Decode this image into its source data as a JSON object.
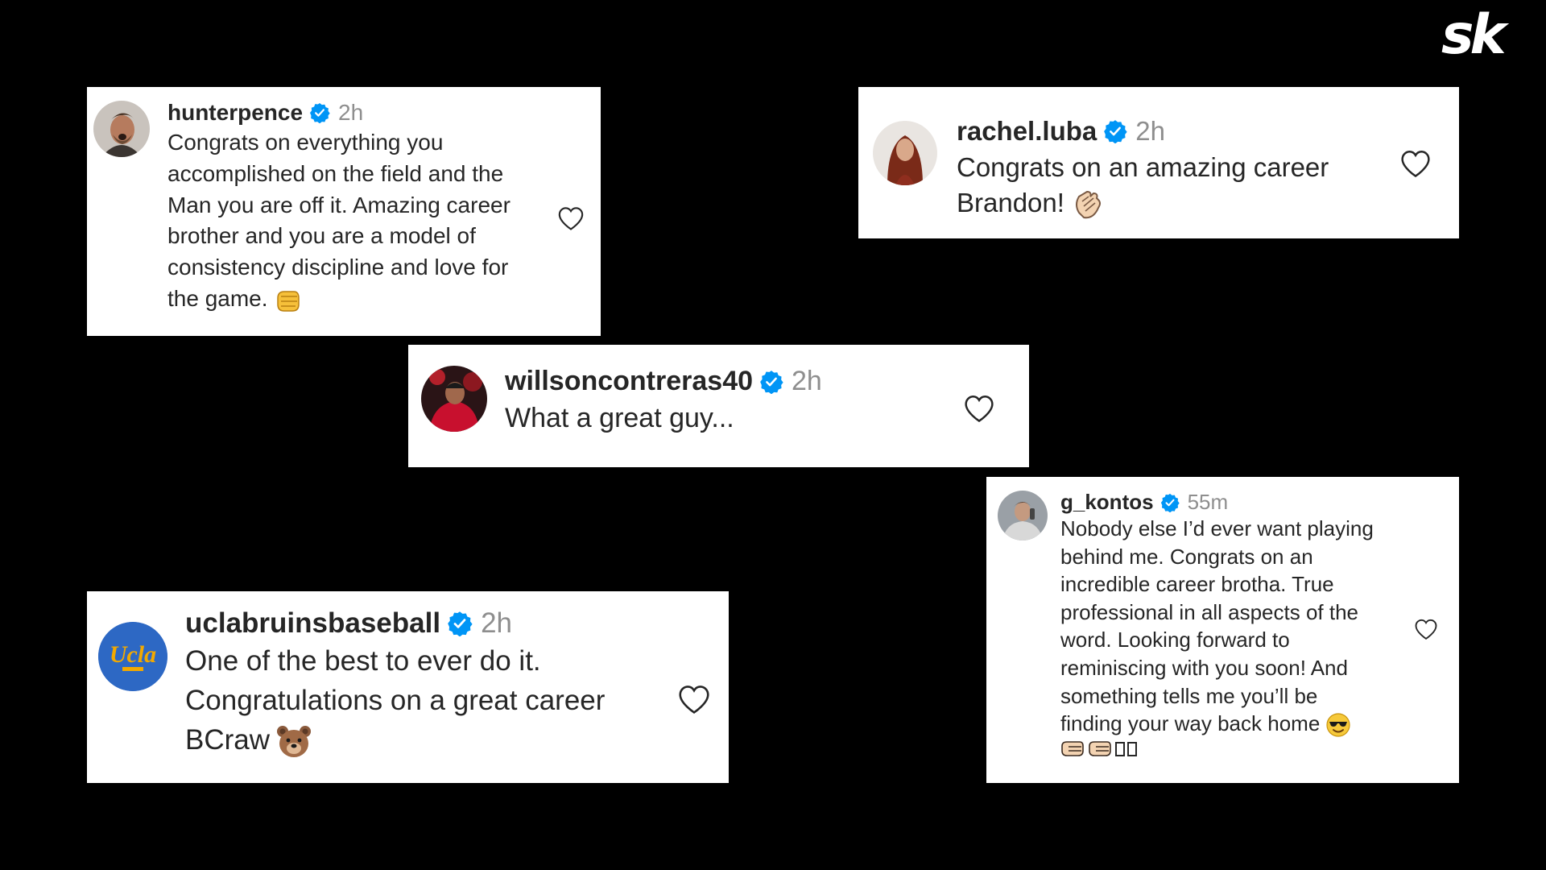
{
  "brand": {
    "logo": "sk"
  },
  "colors": {
    "background": "#000000",
    "verified": "#0095f6",
    "text": "#262626",
    "meta": "#8e8e8e"
  },
  "comments": [
    {
      "username": "hunterpence",
      "verified": true,
      "time": "2h",
      "lines": [
        "Congrats on everything you",
        "accomplished on the field and the",
        "Man you are off it. Amazing career",
        "brother and you are a model of",
        "consistency discipline and love for",
        "the game."
      ],
      "emoji": "oncoming-fist-emoji"
    },
    {
      "username": "rachel.luba",
      "verified": true,
      "time": "2h",
      "lines": [
        "Congrats on an amazing career",
        "Brandon!"
      ],
      "emoji": "clapping-hands-emoji"
    },
    {
      "username": "willsoncontreras40",
      "verified": true,
      "time": "2h",
      "lines": [
        "What a great guy..."
      ]
    },
    {
      "username": "uclabruinsbaseball",
      "verified": true,
      "time": "2h",
      "avatar_text": "Ucla",
      "lines": [
        "One of the best to ever do it.",
        "Congratulations on a great career",
        "BCraw"
      ],
      "emoji": "bear-face-emoji"
    },
    {
      "username": "g_kontos",
      "verified": true,
      "time": "55m",
      "lines": [
        "Nobody else I’d ever want playing",
        "behind me. Congrats on an",
        "incredible career brotha. True",
        "professional in all aspects of the",
        "word. Looking forward to",
        "reminiscing with you soon! And",
        "something tells me you’ll be",
        "finding your way back home"
      ],
      "emoji": "smiling-face-with-sunglasses-emoji",
      "tail": [
        "left-facing-fist-emoji",
        "left-facing-fist-emoji",
        "missing-glyph",
        "missing-glyph"
      ]
    }
  ],
  "icons": {
    "like": "heart-outline-icon",
    "verified": "verified-badge-icon"
  }
}
